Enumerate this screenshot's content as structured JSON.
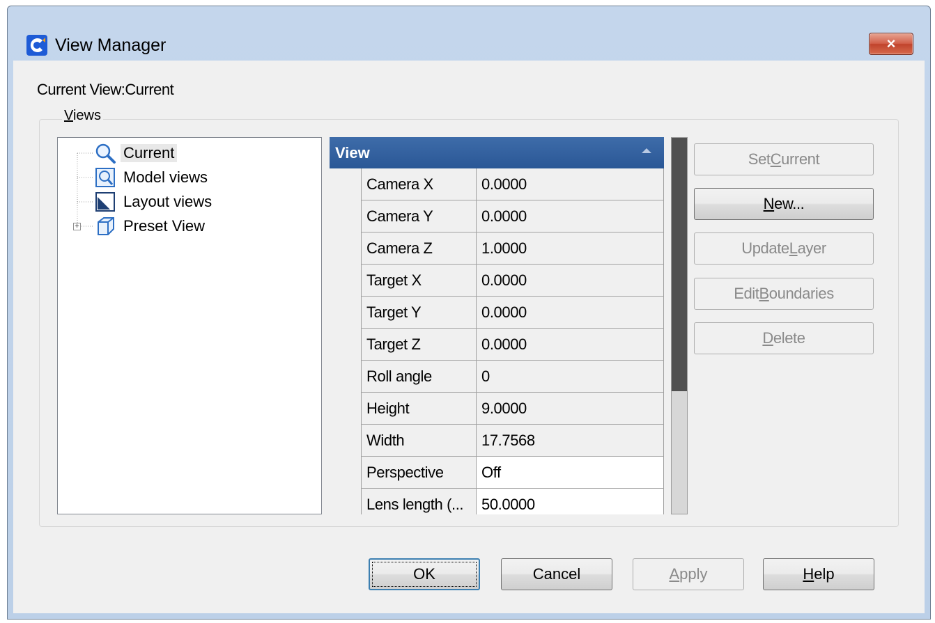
{
  "window": {
    "title": "View Manager",
    "close_label": "×"
  },
  "current_view_label": "Current View:Current",
  "views_group": {
    "label_first": "V",
    "label_rest": "iews"
  },
  "tree": {
    "items": [
      {
        "label": "Current",
        "icon": "magnifier-icon",
        "selected": true
      },
      {
        "label": "Model views",
        "icon": "model-view-icon"
      },
      {
        "label": "Layout views",
        "icon": "layout-view-icon"
      },
      {
        "label": "Preset View",
        "icon": "cube-icon",
        "expander": "+"
      }
    ]
  },
  "properties": {
    "header": "View",
    "rows": [
      {
        "name": "Camera X",
        "value": "0.0000"
      },
      {
        "name": "Camera Y",
        "value": "0.0000"
      },
      {
        "name": "Camera Z",
        "value": "1.0000"
      },
      {
        "name": "Target X",
        "value": "0.0000"
      },
      {
        "name": "Target Y",
        "value": "0.0000"
      },
      {
        "name": "Target Z",
        "value": "0.0000"
      },
      {
        "name": "Roll angle",
        "value": "0"
      },
      {
        "name": "Height",
        "value": "9.0000"
      },
      {
        "name": "Width",
        "value": "17.7568"
      },
      {
        "name": "Perspective",
        "value": "Off"
      },
      {
        "name": "Lens length (...",
        "value": "50.0000"
      }
    ]
  },
  "side_buttons": {
    "set_current": {
      "pre": "Set ",
      "key": "C",
      "post": "urrent"
    },
    "new": {
      "pre": "",
      "key": "N",
      "post": "ew..."
    },
    "update_layer": {
      "pre": "Update ",
      "key": "L",
      "post": "ayer"
    },
    "edit_boundaries": {
      "pre": "Edit ",
      "key": "B",
      "post": "oundaries"
    },
    "delete": {
      "pre": "",
      "key": "D",
      "post": "elete"
    }
  },
  "footer_buttons": {
    "ok": "OK",
    "cancel": "Cancel",
    "apply": {
      "key": "A",
      "post": "pply"
    },
    "help": {
      "key": "H",
      "post": "elp"
    }
  }
}
